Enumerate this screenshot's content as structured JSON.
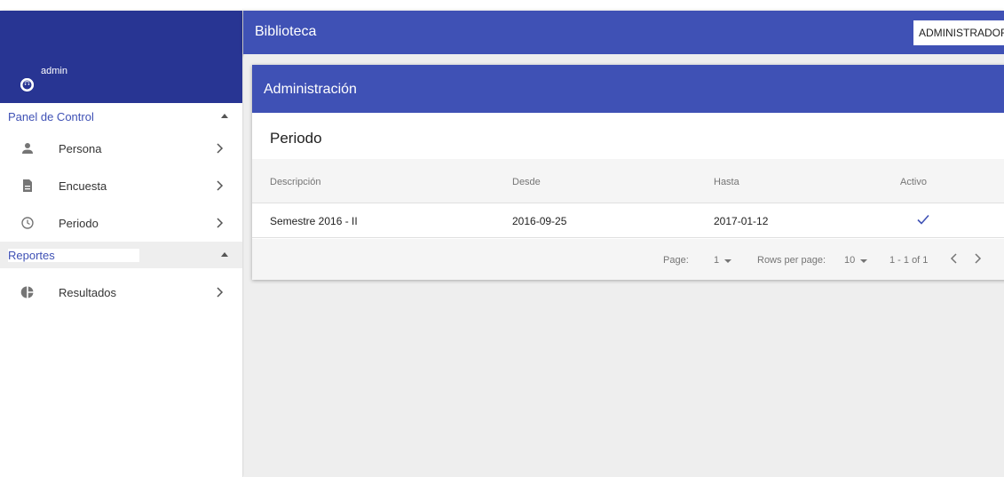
{
  "sidebar": {
    "user": {
      "name": "admin",
      "avatar_icon": "face-icon"
    },
    "sections": [
      {
        "label": "Panel de Control",
        "items": [
          {
            "label": "Persona",
            "icon": "person-icon"
          },
          {
            "label": "Encuesta",
            "icon": "document-icon"
          },
          {
            "label": "Periodo",
            "icon": "clock-icon"
          }
        ]
      },
      {
        "label": "Reportes",
        "items": [
          {
            "label": "Resultados",
            "icon": "pie-chart-icon"
          }
        ]
      }
    ]
  },
  "appbar": {
    "title": "Biblioteca",
    "role_button": "ADMINISTRADOR"
  },
  "card": {
    "title": "Administración",
    "subtitle": "Periodo",
    "table": {
      "columns": [
        "Descripción",
        "Desde",
        "Hasta",
        "Activo"
      ],
      "rows": [
        {
          "descripcion": "Semestre 2016 - II",
          "desde": "2016-09-25",
          "hasta": "2017-01-12",
          "activo": true
        }
      ]
    },
    "pagination": {
      "page_label": "Page:",
      "page_value": "1",
      "rows_label": "Rows per page:",
      "rows_value": "10",
      "range": "1 - 1 of 1"
    }
  },
  "colors": {
    "primary": "#3f51b5",
    "primary_dark": "#283593",
    "background": "#eeeeee"
  }
}
